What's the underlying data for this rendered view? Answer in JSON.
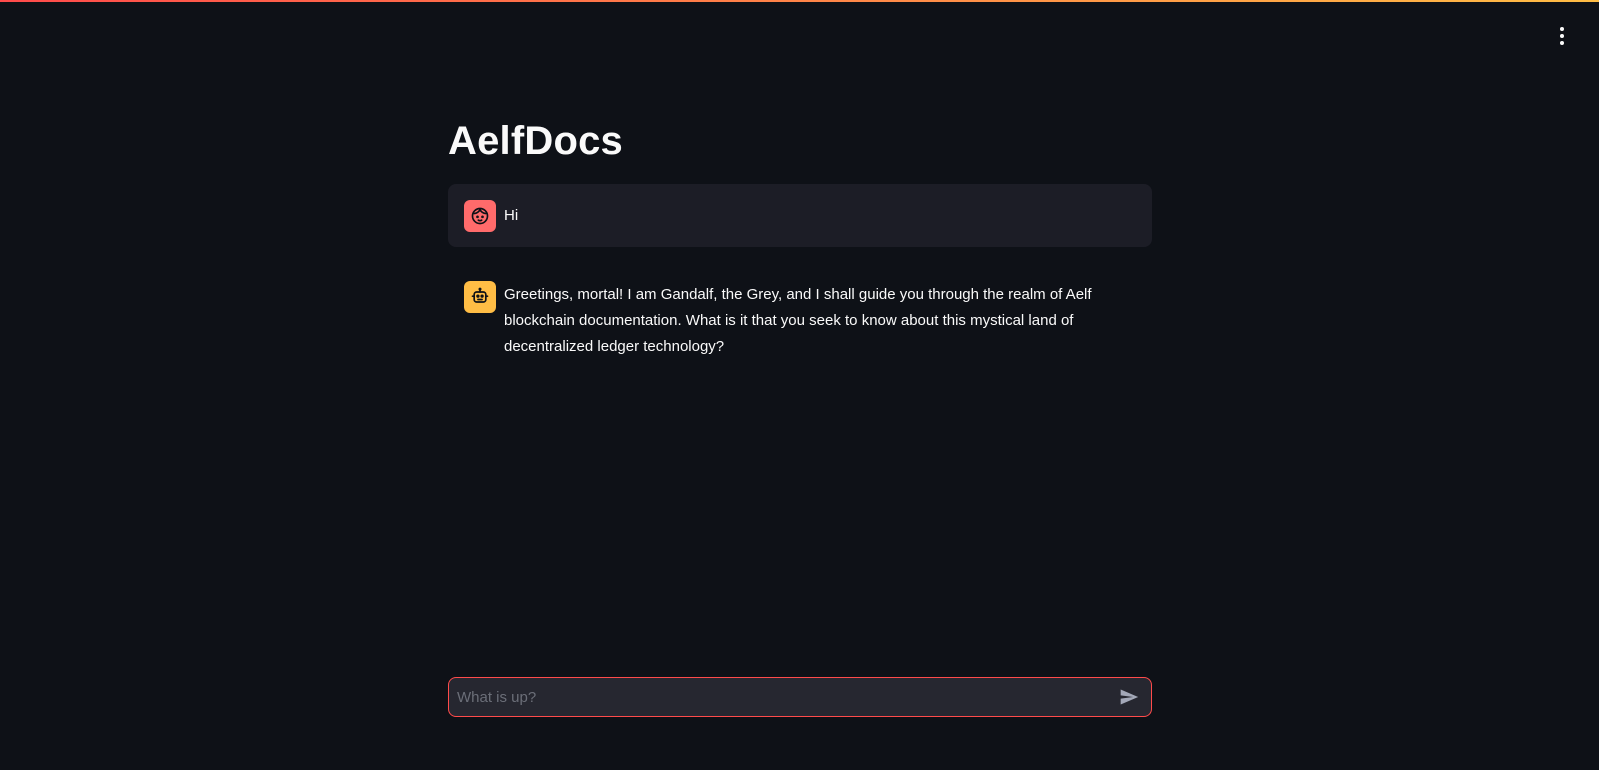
{
  "app": {
    "title": "AelfDocs"
  },
  "menu": {
    "icon": "vertical-dots-icon"
  },
  "chat": {
    "messages": [
      {
        "role": "user",
        "avatar_icon": "user-face-icon",
        "avatar_color": "#ff6b6b",
        "text": "Hi"
      },
      {
        "role": "assistant",
        "avatar_icon": "robot-icon",
        "avatar_color": "#ffbd45",
        "text": "Greetings, mortal! I am Gandalf, the Grey, and I shall guide you through the realm of Aelf blockchain documentation. What is it that you seek to know about this mystical land of decentralized ledger technology?"
      }
    ]
  },
  "input": {
    "placeholder": "What is up?",
    "value": "",
    "send_icon": "send-icon"
  },
  "colors": {
    "background": "#0e1117",
    "user_message_bg": "#1c1d26",
    "input_border": "#ff4b4b",
    "input_bg": "#262730",
    "accent_gradient_start": "#ff4b4b",
    "accent_gradient_end": "#ffbd45"
  }
}
